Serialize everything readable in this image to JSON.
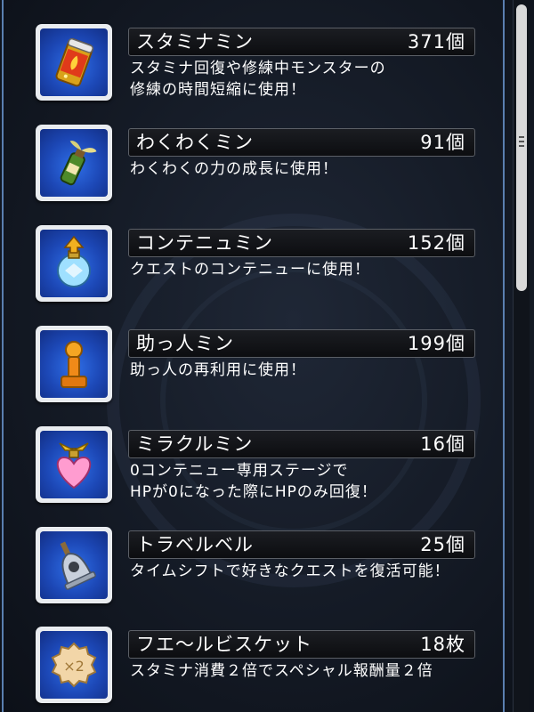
{
  "items": [
    {
      "name": "スタミナミン",
      "count": "371個",
      "desc": [
        "スタミナ回復や修練中モンスターの",
        "修練の時間短縮に使用！"
      ],
      "icon": "stamina-can-icon"
    },
    {
      "name": "わくわくミン",
      "count": "91個",
      "desc": [
        "わくわくの力の成長に使用！"
      ],
      "icon": "sprout-bottle-icon"
    },
    {
      "name": "コンテニュミン",
      "count": "152個",
      "desc": [
        "クエストのコンテニューに使用！"
      ],
      "icon": "continue-bottle-icon"
    },
    {
      "name": "助っ人ミン",
      "count": "199個",
      "desc": [
        "助っ人の再利用に使用！"
      ],
      "icon": "helper-pawn-icon"
    },
    {
      "name": "ミラクルミン",
      "count": "16個",
      "desc": [
        "0コンテニュー専用ステージで",
        "HPが0になった際にHPのみ回復！"
      ],
      "icon": "heart-bottle-icon"
    },
    {
      "name": "トラベルベル",
      "count": "25個",
      "desc": [
        "タイムシフトで好きなクエストを復活可能！"
      ],
      "icon": "bell-icon"
    },
    {
      "name": "フエ〜ルビスケット",
      "count": "18枚",
      "desc": [
        "スタミナ消費２倍でスペシャル報酬量２倍"
      ],
      "icon": "biscuit-icon"
    }
  ],
  "biscuit_badge": "×2",
  "colors": {
    "icon_bg": "#1c47b5",
    "frame": "#e9ecf0",
    "bar": "#15171b"
  }
}
